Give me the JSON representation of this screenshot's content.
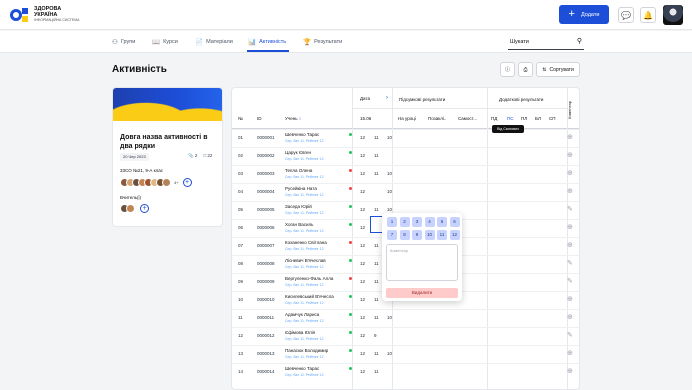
{
  "header": {
    "logo_line1": "ЗДОРОВА",
    "logo_line2": "УКРАЇНА",
    "logo_sub": "ІНФОРМАЦІЙНА СИСТЕМА",
    "add_label": "Додати"
  },
  "tabs": [
    {
      "label": "Групи",
      "icon": "users-icon"
    },
    {
      "label": "Курси",
      "icon": "book-icon"
    },
    {
      "label": "Матеріали",
      "icon": "file-icon"
    },
    {
      "label": "Активність",
      "icon": "chart-icon",
      "active": true
    },
    {
      "label": "Результати",
      "icon": "trophy-icon"
    }
  ],
  "search": {
    "placeholder": "Шукати"
  },
  "page": {
    "title": "Активність",
    "sort_label": "Сортувати"
  },
  "card": {
    "title": "Довга назва активності в два рядки",
    "date": "20 Чер 2023",
    "files": "2",
    "comments": "22",
    "class_label": "33CO №21, 9-А клас",
    "more": "4+",
    "teachers_label": "Вчитель(і)"
  },
  "table": {
    "col_no": "№",
    "col_id": "ID",
    "col_student": "Учень",
    "col_date": "Дата",
    "col_results": "Підсумкові результати",
    "col_extra": "Додаткові результати",
    "col_comment": "Коментар",
    "date_value": "15.06",
    "sub_results": [
      "На уроці",
      "Позаклі..",
      "Самост..."
    ],
    "sub_extra": [
      "ПД",
      "ПС",
      "ПЛ",
      "БЛ",
      "СП"
    ],
    "tooltip": "Від Скопович",
    "rows": [
      {
        "no": "01",
        "id": "0000001",
        "name": "Шевченко Тарас",
        "sub": "Сер. бал 11, Рейтинг 12",
        "status": "green",
        "g1": "12",
        "g2": "11",
        "g3": "10",
        "action": "plus"
      },
      {
        "no": "02",
        "id": "0000002",
        "name": "Царук Євген",
        "sub": "Сер. бал 11, Рейтинг 12",
        "status": "green",
        "g1": "12",
        "g2": "11",
        "g3": "",
        "action": "plus"
      },
      {
        "no": "03",
        "id": "0000003",
        "name": "Тепла Олена",
        "sub": "Сер. бал 11, Рейтинг 12",
        "status": "red",
        "g1": "12",
        "g2": "11",
        "g3": "10",
        "action": "plus"
      },
      {
        "no": "04",
        "id": "0000004",
        "name": "Русейкіна Ната",
        "sub": "Сер. бал 11, Рейтинг 12",
        "status": "red",
        "g1": "12",
        "g2": "",
        "g3": "10",
        "action": "plus"
      },
      {
        "no": "05",
        "id": "0000005",
        "name": "Заседа Юрій",
        "sub": "Сер. бал 11, Рейтинг 12",
        "status": "green",
        "g1": "12",
        "g2": "11",
        "g3": "10",
        "action": "edit"
      },
      {
        "no": "06",
        "id": "0000006",
        "name": "Хоган Василь",
        "sub": "Сер. бал 11, Рейтинг 12",
        "status": "green",
        "g1": "12",
        "g2": "",
        "g3": "",
        "action": "plus"
      },
      {
        "no": "07",
        "id": "0000007",
        "name": "Коханенко Світлана",
        "sub": "Сер. бал 11, Рейтинг 12",
        "status": "red",
        "g1": "12",
        "g2": "11",
        "g3": "",
        "action": "plus"
      },
      {
        "no": "08",
        "id": "0000008",
        "name": "Лісневич В'ячеслав",
        "sub": "Сер. бал 11, Рейтинг 12",
        "status": "green",
        "g1": "12",
        "g2": "11",
        "g3": "",
        "action": "edit"
      },
      {
        "no": "09",
        "id": "0000009",
        "name": "Вергуленко-Фаль Алла",
        "sub": "Сер. бал 11, Рейтинг 12",
        "status": "red",
        "g1": "12",
        "g2": "11",
        "g3": "",
        "action": "edit"
      },
      {
        "no": "10",
        "id": "0000010",
        "name": "Кисилевський В'ячесла",
        "sub": "Сер. бал 11, Рейтинг 12",
        "status": "green",
        "g1": "12",
        "g2": "11",
        "g3": "",
        "action": "plus"
      },
      {
        "no": "11",
        "id": "0000011",
        "name": "Адамчук Лариса",
        "sub": "Сер. бал 11, Рейтинг 12",
        "status": "green",
        "g1": "12",
        "g2": "11",
        "g3": "10",
        "action": "plus"
      },
      {
        "no": "12",
        "id": "0000012",
        "name": "Єфімова Юлія",
        "sub": "Сер. бал 11, Рейтинг 12",
        "status": "green",
        "g1": "12",
        "g2": "9",
        "g3": "",
        "action": "edit"
      },
      {
        "no": "13",
        "id": "0000013",
        "name": "Панасюк Володимир",
        "sub": "Сер. бал 11, Рейтинг 12",
        "status": "green",
        "g1": "12",
        "g2": "11",
        "g3": "10",
        "action": "plus"
      },
      {
        "no": "14",
        "id": "0000014",
        "name": "Шевченко Тарас",
        "sub": "Сер. бал 11, Рейтинг 12",
        "status": "green",
        "g1": "12",
        "g2": "11",
        "g3": "",
        "action": "plus"
      }
    ]
  },
  "popup": {
    "grades": [
      "1",
      "2",
      "3",
      "4",
      "5",
      "6",
      "7",
      "8",
      "9",
      "10",
      "11",
      "12"
    ],
    "comment_placeholder": "Коментар",
    "delete_label": "Видалити"
  },
  "colors": {
    "accent": "#1d4ed8",
    "green": "#22c55e",
    "red": "#ef4444"
  }
}
